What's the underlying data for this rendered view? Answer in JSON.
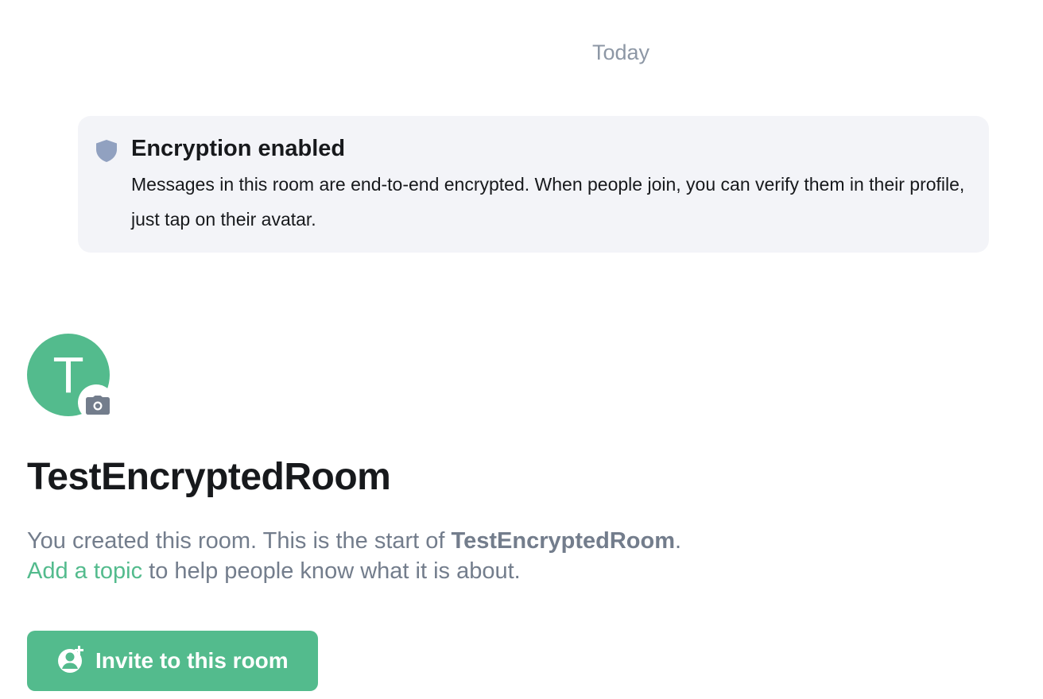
{
  "timeline": {
    "date_separator": "Today"
  },
  "encryption_notice": {
    "title": "Encryption enabled",
    "description": "Messages in this room are end-to-end encrypted. When people join, you can verify them in their profile, just tap on their avatar.",
    "icon": "shield-icon"
  },
  "room": {
    "avatar_letter": "T",
    "avatar_color": "#53bb8d",
    "name": "TestEncryptedRoom",
    "intro_prefix": "You created this room. This is the start of ",
    "intro_room_name": "TestEncryptedRoom",
    "intro_suffix": ".",
    "topic_link": "Add a topic",
    "topic_suffix": " to help people know what it is about.",
    "invite_label": "Invite to this room"
  },
  "colors": {
    "accent": "#53bb8d",
    "notice_bg": "#f3f4f8",
    "secondary_text": "#737d8c",
    "primary_text": "#17191c"
  }
}
